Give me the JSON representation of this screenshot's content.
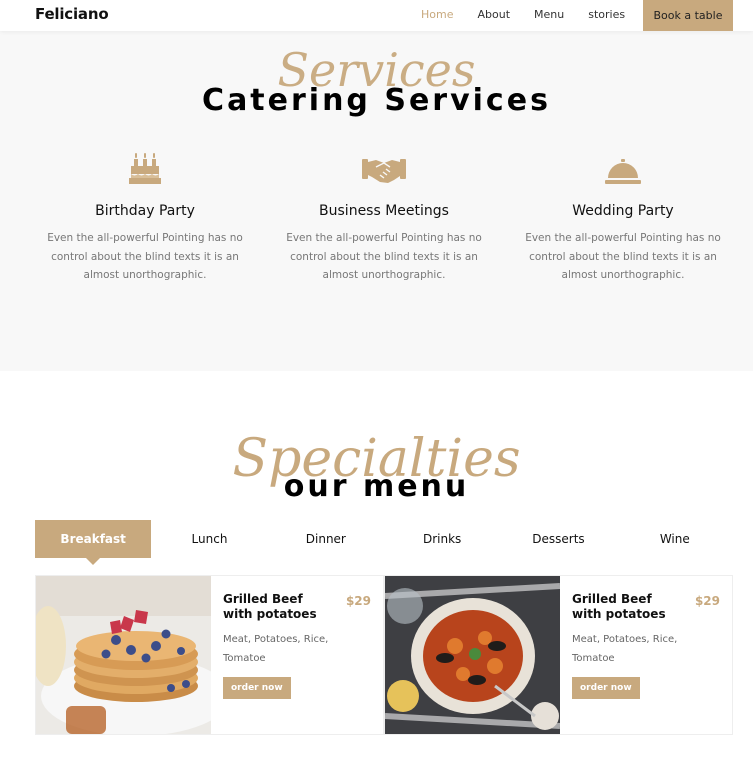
{
  "nav": {
    "brand": "Feliciano",
    "links": [
      "Home",
      "About",
      "Menu",
      "stories"
    ],
    "cta": "Book a table"
  },
  "services": {
    "script_title": "Services",
    "title": "Catering Services",
    "items": [
      {
        "icon": "birthday-cake-icon",
        "title": "Birthday Party",
        "text": "Even the all-powerful Pointing has no control about the blind texts it is an almost unorthographic."
      },
      {
        "icon": "handshake-icon",
        "title": "Business Meetings",
        "text": "Even the all-powerful Pointing has no control about the blind texts it is an almost unorthographic."
      },
      {
        "icon": "food-cloche-icon",
        "title": "Wedding Party",
        "text": "Even the all-powerful Pointing has no control about the blind texts it is an almost unorthographic."
      }
    ]
  },
  "menu": {
    "script_title": "Specialties",
    "title": "our menu",
    "tabs": [
      "Breakfast",
      "Lunch",
      "Dinner",
      "Drinks",
      "Desserts",
      "Wine"
    ],
    "active_tab": "Breakfast",
    "items": [
      {
        "name": "Grilled Beef with potatoes",
        "price": "$29",
        "desc": "Meat, Potatoes, Rice, Tomatoe",
        "button": "order now"
      },
      {
        "name": "Grilled Beef with potatoes",
        "price": "$29",
        "desc": "Meat, Potatoes, Rice, Tomatoe",
        "button": "order now"
      }
    ]
  },
  "colors": {
    "accent": "#c8a97e",
    "section_bg": "#f8f8f8"
  }
}
